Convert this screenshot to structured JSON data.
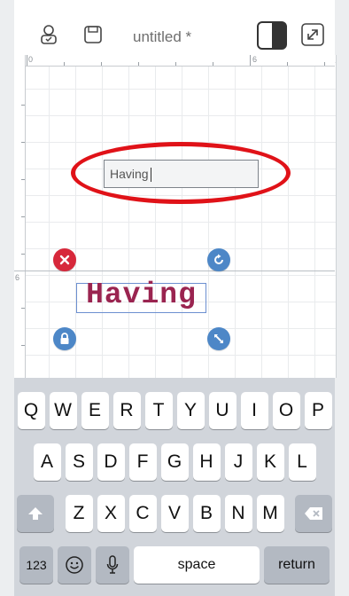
{
  "toolbar": {
    "title": "untitled *",
    "icons": [
      "user-sync-icon",
      "save-icon",
      "layout-toggle-icon",
      "fullscreen-icon"
    ]
  },
  "ruler": {
    "top_labels": [
      "0",
      "6"
    ],
    "left_label": "6"
  },
  "text_input": {
    "value": "Having"
  },
  "text_object": {
    "text": "Having",
    "color": "#9a2450"
  },
  "highlight_color": "#e01218",
  "keyboard": {
    "row1": [
      "Q",
      "W",
      "E",
      "R",
      "T",
      "Y",
      "U",
      "I",
      "O",
      "P"
    ],
    "row2": [
      "A",
      "S",
      "D",
      "F",
      "G",
      "H",
      "J",
      "K",
      "L"
    ],
    "row3": [
      "Z",
      "X",
      "C",
      "V",
      "B",
      "N",
      "M"
    ],
    "numbers_label": "123",
    "space_label": "space",
    "return_label": "return"
  }
}
